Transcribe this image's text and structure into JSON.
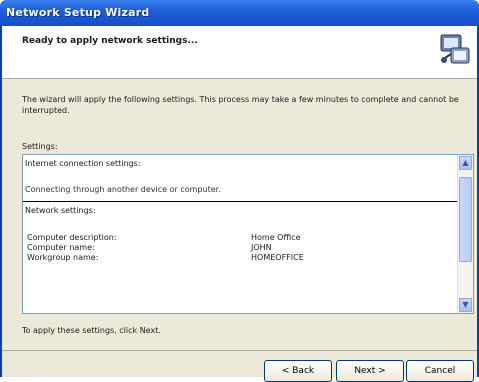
{
  "window": {
    "title": "Network Setup Wizard"
  },
  "header": {
    "heading": "Ready to apply network settings..."
  },
  "description": "The wizard will apply the following settings. This process may take a few minutes to complete and cannot be interrupted.",
  "settings": {
    "label": "Settings:",
    "internet_section": "Internet connection settings:",
    "internet_line": "Connecting through another device or computer.",
    "network_section": "Network settings:",
    "items": [
      {
        "key": "Computer description:",
        "value": "Home Office"
      },
      {
        "key": "Computer name:",
        "value": "JOHN"
      },
      {
        "key": "Workgroup name:",
        "value": "HOMEOFFICE"
      }
    ]
  },
  "apply_text": "To apply these settings, click Next.",
  "buttons": {
    "back": "< Back",
    "next": "Next >",
    "cancel": "Cancel"
  },
  "icons": {
    "wizard": "network-wizard-icon",
    "scroll_up": "scroll-up-icon",
    "scroll_down": "scroll-down-icon"
  }
}
